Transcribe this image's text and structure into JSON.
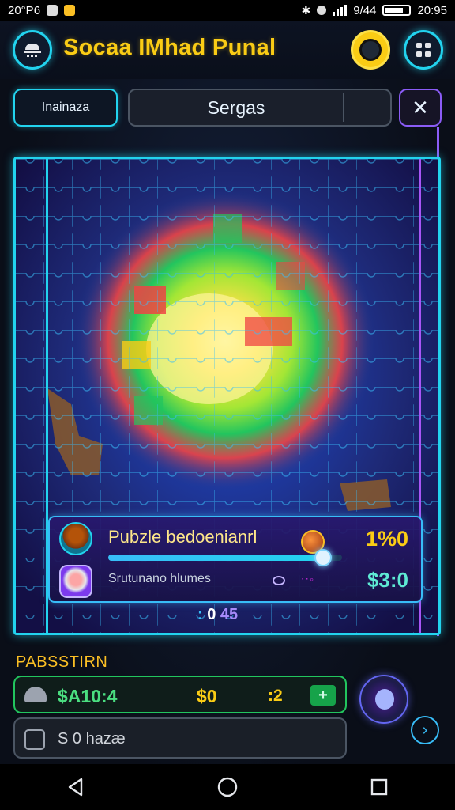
{
  "status_bar": {
    "left_text": "20°P6",
    "right_text": "9/44",
    "time": "20:95"
  },
  "header": {
    "title": "Socaa IMhad Punal",
    "menu_icon": "cloud-menu-icon",
    "mascot_icon": "mascot-avatar-icon",
    "grid_icon": "grid-menu-icon"
  },
  "tabs": {
    "left_label": "Inainaza",
    "search_label": "Sergas",
    "close_label": "✕"
  },
  "scoreboard": {
    "title": "Pubzle bedoenianrl",
    "percent": "1%0",
    "progress": 0.92,
    "subtitle": "Srutunano hlumes",
    "sub_dots": "ᐧᐧ◦",
    "money": "$3:0"
  },
  "counter": {
    "a": ":",
    "b": "0",
    "c": "45"
  },
  "panel": {
    "section_title": "PABSSTIRN",
    "row1": {
      "value_a": "$A10:4",
      "value_b": "$0",
      "value_c": ":2",
      "plus_label": "+"
    },
    "row2": {
      "text": "S 0 hazæ"
    }
  },
  "colors": {
    "accent_cyan": "#22d3ee",
    "accent_purple": "#a855f7",
    "title_yellow": "#facc15",
    "money_green": "#4ade80"
  }
}
